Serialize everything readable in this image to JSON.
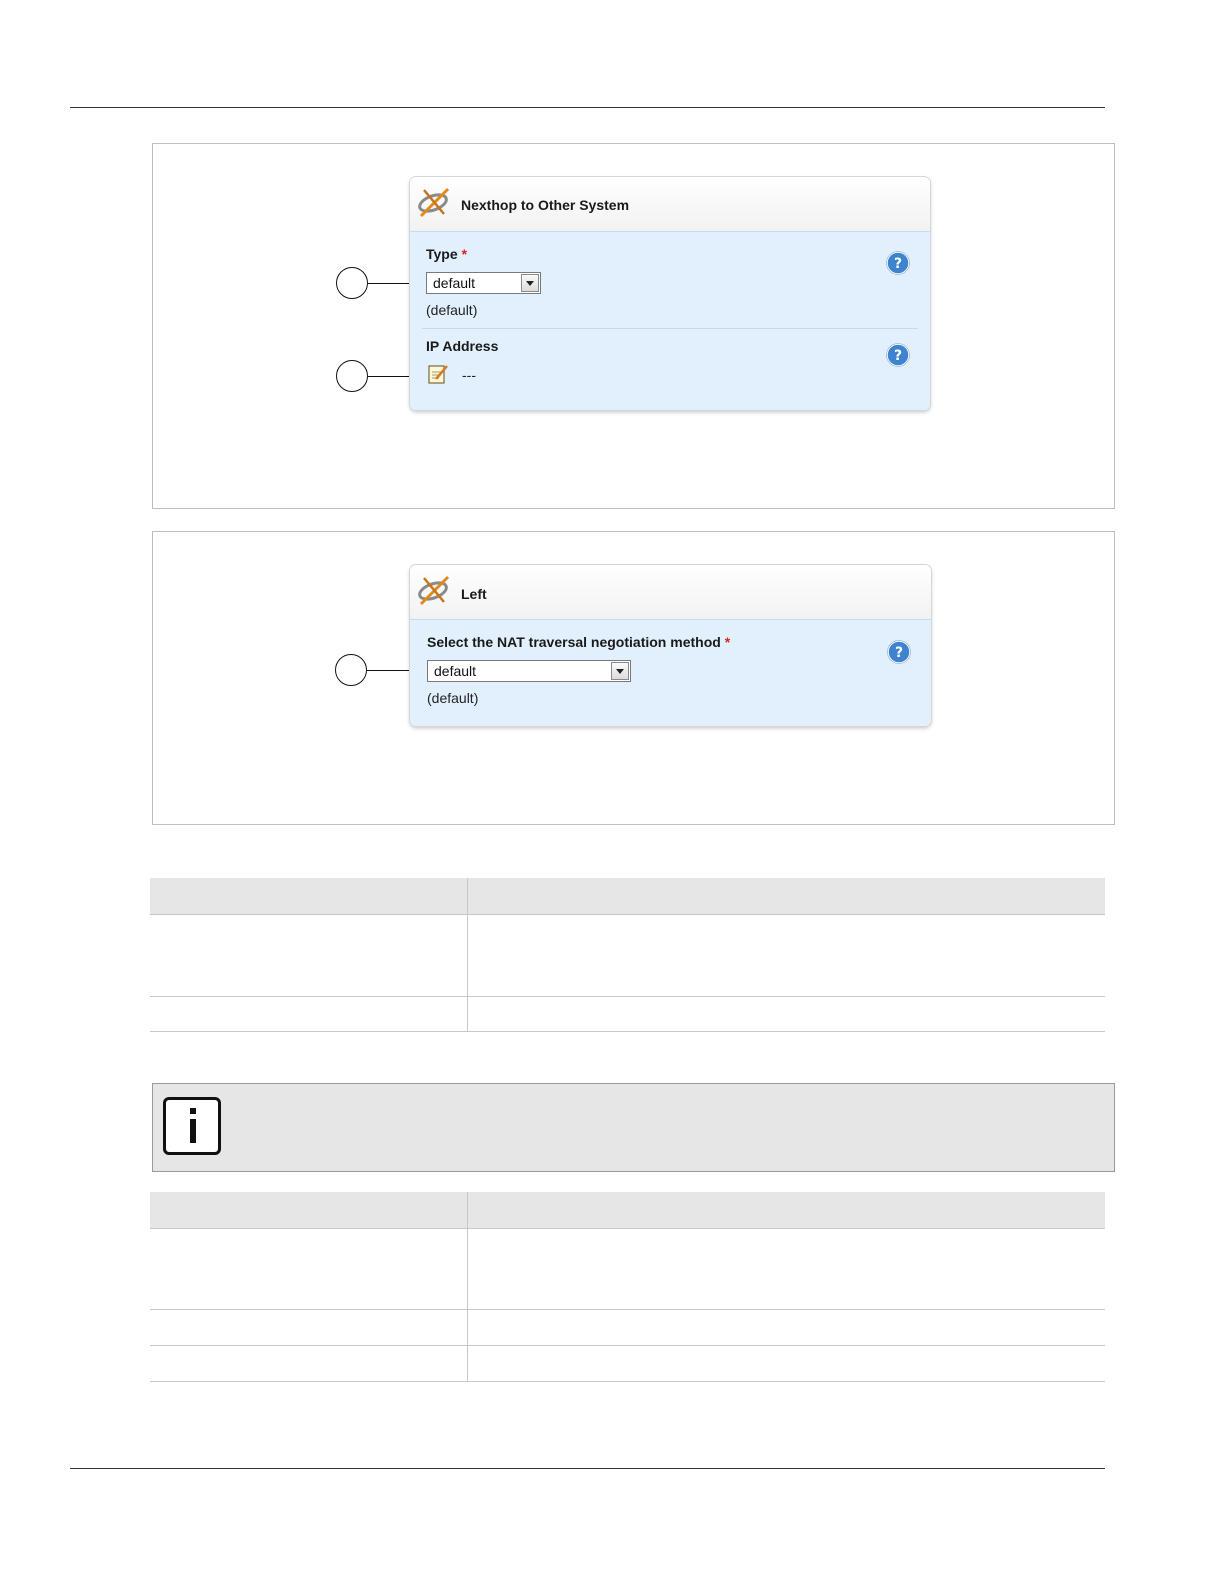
{
  "figure1": {
    "panel_title": "Nexthop to Other System",
    "type_field": {
      "label": "Type",
      "required": "*",
      "value": "default",
      "default_note": "(default)"
    },
    "ip_field": {
      "label": "IP Address",
      "value": "---"
    },
    "icons": {
      "title": "satellite-tools-icon",
      "help": "help-icon",
      "edit": "edit-icon"
    }
  },
  "figure2": {
    "panel_title": "Left",
    "nat_field": {
      "label": "Select the NAT traversal negotiation method",
      "required": "*",
      "value": "default",
      "default_note": "(default)"
    }
  },
  "colors": {
    "panel_body": "#e1f0fc",
    "required": "#e0201c",
    "help": "#3d83cf",
    "note_bg": "#e6e6e6",
    "table_header": "#e6e6e6"
  }
}
